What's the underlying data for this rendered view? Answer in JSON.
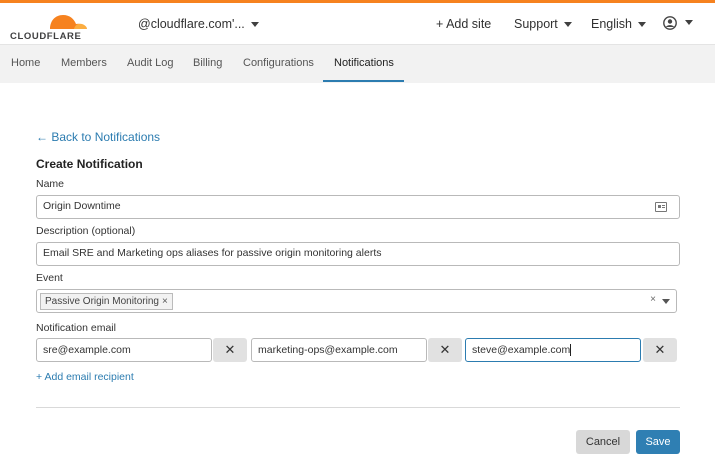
{
  "header": {
    "logo_text": "CLOUDFLARE",
    "account": "@cloudflare.com'...",
    "add_site": "+ Add site",
    "support": "Support",
    "language": "English"
  },
  "nav": {
    "tabs": [
      "Home",
      "Members",
      "Audit Log",
      "Billing",
      "Configurations",
      "Notifications"
    ],
    "active": "Notifications"
  },
  "form": {
    "back_link": "← Back to Notifications",
    "title": "Create Notification",
    "name_label": "Name",
    "name_value": "Origin Downtime",
    "description_label": "Description (optional)",
    "description_value": "Email SRE and Marketing ops aliases for passive origin monitoring alerts",
    "event_label": "Event",
    "event_tag": "Passive Origin Monitoring",
    "email_label": "Notification email",
    "emails": [
      "sre@example.com",
      "marketing-ops@example.com",
      "steve@example.com"
    ],
    "add_recipient": "+ Add email recipient",
    "cancel": "Cancel",
    "save": "Save"
  },
  "colors": {
    "accent": "#f6821f",
    "link": "#2c7cb0",
    "save_button": "#2f7fb3"
  }
}
